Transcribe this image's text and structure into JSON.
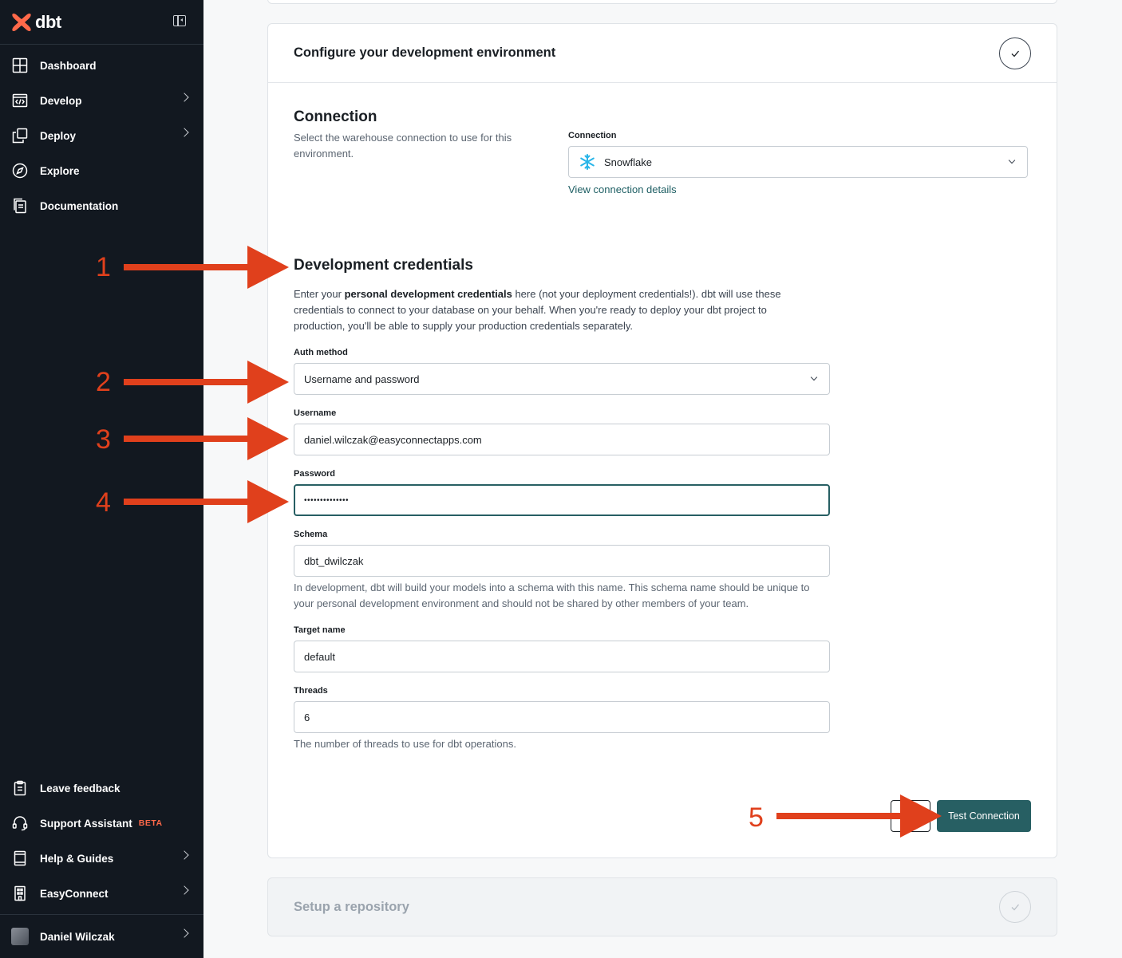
{
  "brand": {
    "name": "dbt"
  },
  "sidebar": {
    "items": [
      {
        "label": "Dashboard",
        "icon": "dashboard-icon",
        "chevron": false
      },
      {
        "label": "Develop",
        "icon": "code-window-icon",
        "chevron": true
      },
      {
        "label": "Deploy",
        "icon": "deploy-icon",
        "chevron": true
      },
      {
        "label": "Explore",
        "icon": "compass-icon",
        "chevron": false
      },
      {
        "label": "Documentation",
        "icon": "docs-icon",
        "chevron": false
      }
    ],
    "bottom": [
      {
        "label": "Leave feedback",
        "icon": "clipboard-icon"
      },
      {
        "label": "Support Assistant",
        "icon": "headset-icon",
        "badge": "BETA"
      },
      {
        "label": "Help & Guides",
        "icon": "book-icon",
        "chevron": true
      },
      {
        "label": "EasyConnect",
        "icon": "building-icon",
        "chevron": true
      },
      {
        "label": "Daniel Wilczak",
        "icon": "avatar",
        "chevron": true
      }
    ]
  },
  "card": {
    "title": "Configure your development environment",
    "connection": {
      "heading": "Connection",
      "description": "Select the warehouse connection to use for this environment.",
      "field_label": "Connection",
      "value": "Snowflake",
      "link": "View connection details"
    },
    "credentials": {
      "heading": "Development credentials",
      "desc_pre": "Enter your ",
      "desc_bold": "personal development credentials",
      "desc_post": " here (not your deployment credentials!). dbt will use these credentials to connect to your database on your behalf. When you're ready to deploy your dbt project to production, you'll be able to supply your production credentials separately.",
      "auth_label": "Auth method",
      "auth_value": "Username and password",
      "username_label": "Username",
      "username_value": "daniel.wilczak@easyconnectapps.com",
      "password_label": "Password",
      "password_value": "••••••••••••••",
      "schema_label": "Schema",
      "schema_value": "dbt_dwilczak",
      "schema_help": "In development, dbt will build your models into a schema with this name. This schema name should be unique to your personal development environment and should not be shared by other members of your team.",
      "target_label": "Target name",
      "target_value": "default",
      "threads_label": "Threads",
      "threads_value": "6",
      "threads_help": "The number of threads to use for dbt operations."
    },
    "test_button": "Test Connection"
  },
  "next_card": {
    "title": "Setup a repository"
  },
  "annotations": [
    "1",
    "2",
    "3",
    "4",
    "5"
  ],
  "colors": {
    "sidebar": "#121820",
    "primary": "#275f63",
    "annotation": "#e0401c",
    "brand": "#ff694a"
  }
}
